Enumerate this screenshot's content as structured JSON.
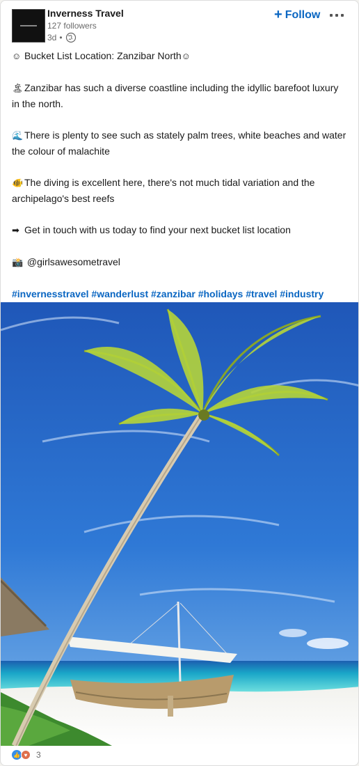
{
  "header": {
    "company_name": "Inverness Travel",
    "followers": "127 followers",
    "time": "3d",
    "dot": "•",
    "follow_label": "Follow",
    "follow_plus": "+",
    "globe_icon": "globe-icon",
    "more_icon": "more-horizontal-icon"
  },
  "post": {
    "lines": [
      {
        "emoji": "☺",
        "text": "Bucket List Location: Zanzibar North",
        "emoji_after": "☺"
      },
      {
        "emoji": "🏝",
        "text": "Zanzibar has such a diverse coastline including the idyllic barefoot luxury in the north."
      },
      {
        "emoji": "🌊",
        "text": "There is plenty to see such as stately palm trees, white beaches and water the colour of malachite"
      },
      {
        "emoji": "🐠",
        "text": "The diving is excellent here, there's not much tidal variation and the archipelago's best reefs"
      },
      {
        "emoji": "➡",
        "text": "Get in touch with us today to find your next bucket list location"
      },
      {
        "emoji": "📸",
        "text": " @girlsawesometravel"
      }
    ],
    "hashtags": [
      "#invernesstravel",
      "#wanderlust",
      "#zanzibar",
      "#holidays",
      "#travel",
      "#industry"
    ]
  },
  "reactions": {
    "count": "3",
    "icons": [
      "like-icon",
      "love-icon"
    ],
    "colors": {
      "like": "#378fe9",
      "love": "#df704d"
    }
  },
  "colors": {
    "accent": "#0a66c2"
  }
}
